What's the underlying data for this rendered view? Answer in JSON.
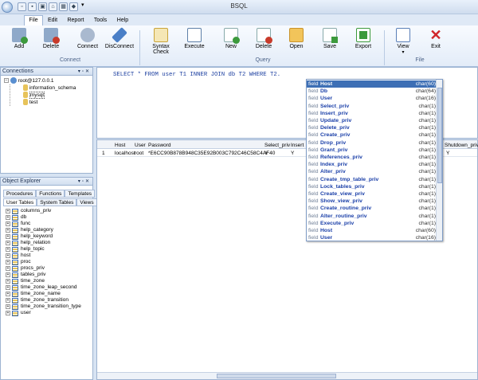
{
  "window": {
    "title": "BSQL"
  },
  "menu": [
    "File",
    "Edit",
    "Report",
    "Tools",
    "Help"
  ],
  "ribbon": {
    "buttons": [
      {
        "label": "Add",
        "icon": "add-database-icon",
        "color": "#3c9a3c"
      },
      {
        "label": "Delete",
        "icon": "delete-database-icon",
        "color": "#c83a2a"
      },
      {
        "label": "Connect",
        "icon": "connect-icon",
        "color": "#5a7fb8"
      },
      {
        "label": "DisConnect",
        "icon": "disconnect-icon",
        "color": "#4a7fc7"
      },
      {
        "label": "Syntax\nCheck",
        "icon": "syntax-check-icon",
        "color": "#e0b640"
      },
      {
        "label": "Execute",
        "icon": "execute-icon",
        "color": "#5d7fa8"
      },
      {
        "label": "New",
        "icon": "new-query-icon",
        "color": "#3c9a3c"
      },
      {
        "label": "Delete",
        "icon": "delete-query-icon",
        "color": "#c83a2a"
      },
      {
        "label": "Open",
        "icon": "open-folder-icon",
        "color": "#e7b23c"
      },
      {
        "label": "Save",
        "icon": "save-icon",
        "color": "#3c9a3c"
      },
      {
        "label": "Export",
        "icon": "export-icon",
        "color": "#3c9a3c"
      },
      {
        "label": "View",
        "icon": "view-icon",
        "color": "#5a7fb8"
      },
      {
        "label": "Exit",
        "icon": "exit-icon",
        "color": "#d0262a"
      }
    ],
    "groups": [
      "Connect",
      "Query",
      "File"
    ]
  },
  "connections": {
    "title": "Connections",
    "server": "root@127.0.0.1",
    "databases": [
      "information_schema",
      "mysql",
      "test"
    ]
  },
  "explorer": {
    "title": "Object Explorer",
    "tabs_row1": [
      "Procedures",
      "Functions",
      "Templates"
    ],
    "tabs_row2": [
      "User Tables",
      "System Tables",
      "Views"
    ],
    "tables": [
      "columns_priv",
      "db",
      "func",
      "help_category",
      "help_keyword",
      "help_relation",
      "help_topic",
      "host",
      "proc",
      "procs_priv",
      "tables_priv",
      "time_zone",
      "time_zone_leap_second",
      "time_zone_name",
      "time_zone_transition",
      "time_zone_transition_type",
      "user"
    ]
  },
  "editor": {
    "sql": "SELECT * FROM user T1 INNER JOIN db T2 WHERE T2."
  },
  "grid": {
    "headers": [
      "Host",
      "User",
      "Password",
      "Select_priv",
      "Insert",
      "",
      "Shutdown_priv"
    ],
    "row": {
      "num": "1",
      "host": "localhost",
      "user": "root",
      "password": "*E6CC90B878B948C35E92B003C792C46C58C4AF40",
      "select": "Y",
      "insert": "Y",
      "shutdown": "Y"
    }
  },
  "autocomplete": [
    {
      "kind": "field",
      "name": "Host",
      "type": "char(60)"
    },
    {
      "kind": "field",
      "name": "Db",
      "type": "char(64)"
    },
    {
      "kind": "field",
      "name": "User",
      "type": "char(16)"
    },
    {
      "kind": "field",
      "name": "Select_priv",
      "type": "char(1)"
    },
    {
      "kind": "field",
      "name": "Insert_priv",
      "type": "char(1)"
    },
    {
      "kind": "field",
      "name": "Update_priv",
      "type": "char(1)"
    },
    {
      "kind": "field",
      "name": "Delete_priv",
      "type": "char(1)"
    },
    {
      "kind": "field",
      "name": "Create_priv",
      "type": "char(1)"
    },
    {
      "kind": "field",
      "name": "Drop_priv",
      "type": "char(1)"
    },
    {
      "kind": "field",
      "name": "Grant_priv",
      "type": "char(1)"
    },
    {
      "kind": "field",
      "name": "References_priv",
      "type": "char(1)"
    },
    {
      "kind": "field",
      "name": "Index_priv",
      "type": "char(1)"
    },
    {
      "kind": "field",
      "name": "Alter_priv",
      "type": "char(1)"
    },
    {
      "kind": "field",
      "name": "Create_tmp_table_priv",
      "type": "char(1)"
    },
    {
      "kind": "field",
      "name": "Lock_tables_priv",
      "type": "char(1)"
    },
    {
      "kind": "field",
      "name": "Create_view_priv",
      "type": "char(1)"
    },
    {
      "kind": "field",
      "name": "Show_view_priv",
      "type": "char(1)"
    },
    {
      "kind": "field",
      "name": "Create_routine_priv",
      "type": "char(1)"
    },
    {
      "kind": "field",
      "name": "Alter_routine_priv",
      "type": "char(1)"
    },
    {
      "kind": "field",
      "name": "Execute_priv",
      "type": "char(1)"
    },
    {
      "kind": "field",
      "name": "Host",
      "type": "char(60)"
    },
    {
      "kind": "field",
      "name": "User",
      "type": "char(16)"
    }
  ]
}
